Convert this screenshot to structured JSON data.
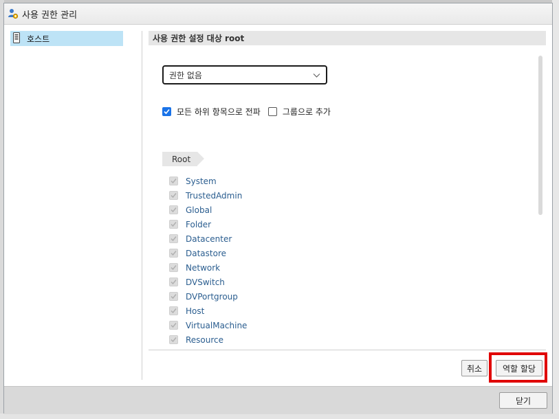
{
  "window": {
    "title": "사용 권한 관리",
    "icon": "user-permissions-icon"
  },
  "sidebar": {
    "items": [
      {
        "label": "호스트",
        "icon": "host-device-icon",
        "selected": true
      }
    ]
  },
  "panel": {
    "header": "사용 권한 설정 대상 root",
    "role_select": {
      "value": "권한 없음",
      "icon": "chevron-down-icon"
    },
    "options": {
      "propagate": {
        "label": "모든 하위 항목으로 전파",
        "checked": true
      },
      "add_group": {
        "label": "그룹으로 추가",
        "checked": false
      }
    },
    "breadcrumb": {
      "root": "Root"
    },
    "privileges": [
      "System",
      "TrustedAdmin",
      "Global",
      "Folder",
      "Datacenter",
      "Datastore",
      "Network",
      "DVSwitch",
      "DVPortgroup",
      "Host",
      "VirtualMachine",
      "Resource"
    ]
  },
  "actions": {
    "cancel": "취소",
    "assign_role": "역할 할당"
  },
  "footer": {
    "close": "닫기"
  },
  "colors": {
    "accent": "#1a73e8",
    "selected_row": "#bde3f6",
    "highlight": "#e00000",
    "link": "#2a5d8f"
  }
}
